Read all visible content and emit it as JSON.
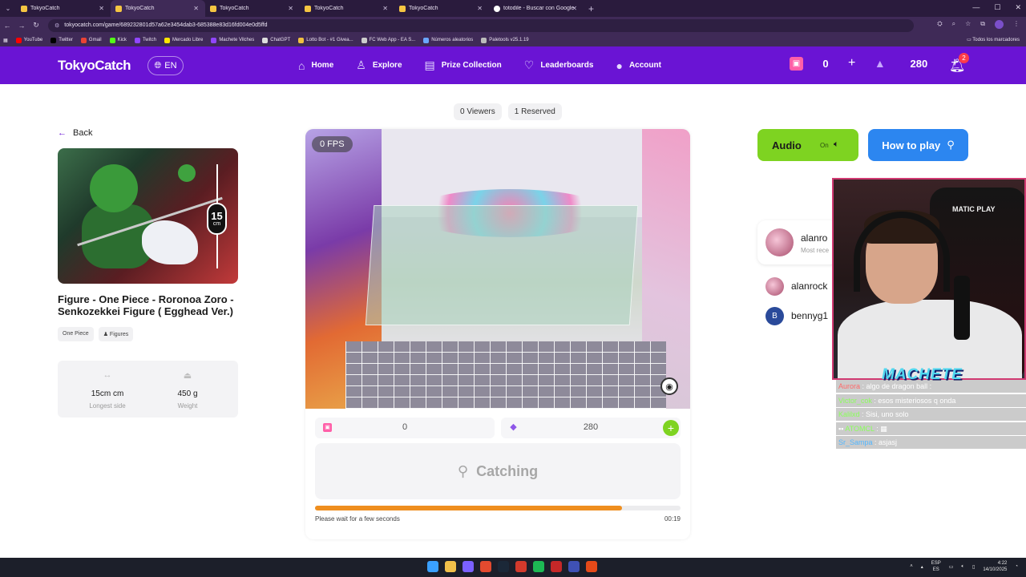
{
  "browser": {
    "tabs": [
      {
        "label": "TokyoCatch",
        "active": false
      },
      {
        "label": "TokyoCatch",
        "active": true
      },
      {
        "label": "TokyoCatch",
        "active": false
      },
      {
        "label": "TokyoCatch",
        "active": false
      },
      {
        "label": "TokyoCatch",
        "active": false
      },
      {
        "label": "totodile - Buscar con Google",
        "active": false
      }
    ],
    "url": "tokyocatch.com/game/689232801d57a62e3454dab3-685388e83d16fd004e0d5ffd",
    "bookmarks": [
      "YouTube",
      "Twitter",
      "Gmail",
      "Kick",
      "Twitch",
      "Mercado Libre",
      "Machete Vilches",
      "ChatGPT",
      "Lotto Bot - #1 Givea...",
      "FC Web App - EA S...",
      "Números aleatorios",
      "Paletools v25.1.19"
    ],
    "all_bookmarks": "Todos los marcadores"
  },
  "header": {
    "logo": "TokyoCatch",
    "lang": "EN",
    "nav": [
      {
        "label": "Home",
        "icon": "home-icon"
      },
      {
        "label": "Explore",
        "icon": "explore-icon"
      },
      {
        "label": "Prize Collection",
        "icon": "prize-collection-icon"
      },
      {
        "label": "Leaderboards",
        "icon": "leaderboards-icon"
      },
      {
        "label": "Account",
        "icon": "account-icon"
      }
    ],
    "tickets": "0",
    "gems": "280",
    "notifications": "2"
  },
  "product": {
    "back_label": "Back",
    "size_value": "15",
    "size_unit": "cm",
    "title": "Figure - One Piece - Roronoa Zoro - Senkozekkei Figure ( Egghead Ver.)",
    "tags": [
      "One Piece",
      "Figures"
    ],
    "specs": [
      {
        "value": "15cm cm",
        "label": "Longest side"
      },
      {
        "value": "450 g",
        "label": "Weight"
      }
    ]
  },
  "game": {
    "viewers": "0 Viewers",
    "reserved": "1 Reserved",
    "fps": "0 FPS",
    "ticket_balance": "0",
    "gem_balance": "280",
    "catch_label": "Catching",
    "progress": 0.84,
    "wait_message": "Please wait for a few seconds",
    "timer": "00:19"
  },
  "side": {
    "audio_label": "Audio",
    "audio_state": "On",
    "howto_label": "How to play",
    "rank_name": "alanro",
    "rank_sub": "Most rece",
    "players": [
      {
        "name": "alanrock",
        "letter": ""
      },
      {
        "name": "bennyg1",
        "letter": "B"
      }
    ]
  },
  "stream": {
    "streamer": "MACHETE",
    "sponsor": "MATIC PLAY",
    "chat": [
      {
        "user": "Aurora",
        "msg": ": algo de dragon ball :"
      },
      {
        "user": "Victor_cok",
        "msg": ": esos misteriosos q onda"
      },
      {
        "user": "Kalilxd",
        "msg": ": Sisi, uno solo"
      },
      {
        "user": "ATOMCL",
        "msg": ":"
      },
      {
        "user": "Sr_Sampa",
        "msg": ": asjasj"
      }
    ]
  },
  "taskbar": {
    "lang": "ESP",
    "lang2": "ES",
    "time": "4:22",
    "date": "14/10/2025"
  }
}
